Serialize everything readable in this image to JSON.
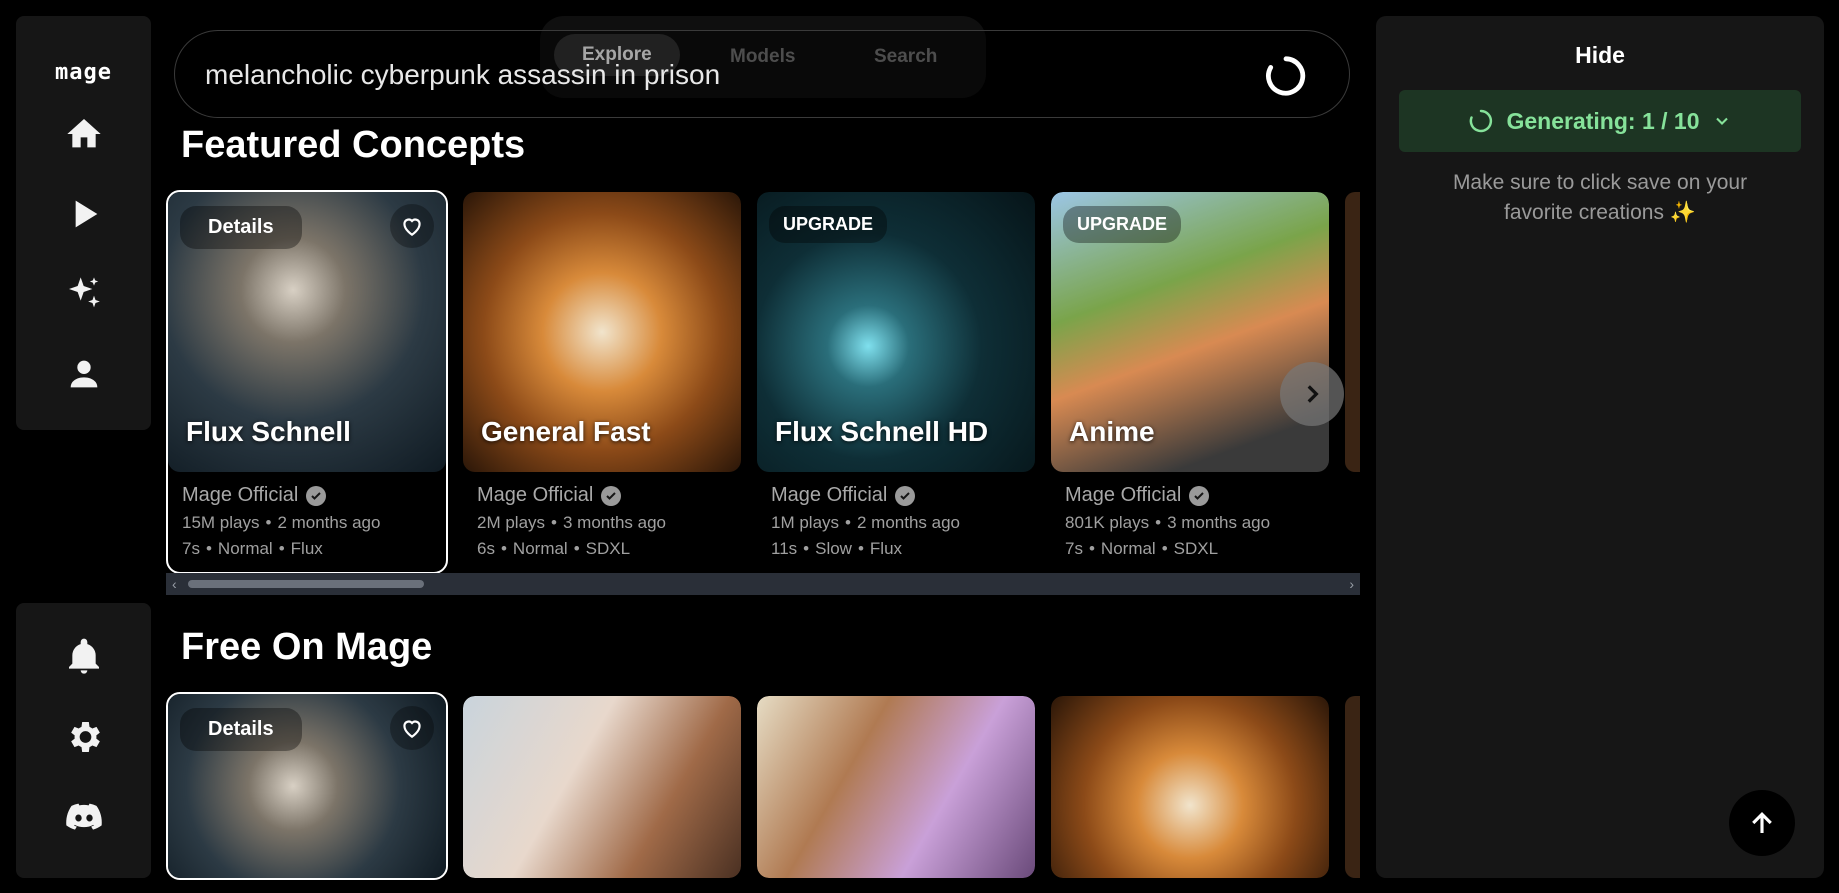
{
  "logo": "mage",
  "tabs": [
    {
      "label": "Explore"
    },
    {
      "label": "Models"
    },
    {
      "label": "Search"
    }
  ],
  "search": {
    "value": "melancholic cyberpunk assassin in prison"
  },
  "featured": {
    "title": "Featured Concepts",
    "cards": [
      {
        "title": "Flux Schnell",
        "badge": "Details",
        "author": "Mage Official",
        "plays": "15M plays",
        "age": "2 months ago",
        "time": "7s",
        "speed": "Normal",
        "model": "Flux"
      },
      {
        "title": "General Fast",
        "badge": "",
        "author": "Mage Official",
        "plays": "2M plays",
        "age": "3 months ago",
        "time": "6s",
        "speed": "Normal",
        "model": "SDXL"
      },
      {
        "title": "Flux Schnell HD",
        "badge": "UPGRADE",
        "author": "Mage Official",
        "plays": "1M plays",
        "age": "2 months ago",
        "time": "11s",
        "speed": "Slow",
        "model": "Flux"
      },
      {
        "title": "Anime",
        "badge": "UPGRADE",
        "author": "Mage Official",
        "plays": "801K plays",
        "age": "3 months ago",
        "time": "7s",
        "speed": "Normal",
        "model": "SDXL"
      }
    ]
  },
  "free": {
    "title": "Free On Mage",
    "cards": [
      {
        "badge": "Details"
      }
    ]
  },
  "panel": {
    "hide_label": "Hide",
    "generating_label": "Generating: 1 / 10",
    "note": "Make sure to click save on your favorite creations ✨"
  },
  "colors": {
    "generating_text": "#86e29a",
    "generating_bg": "#1d3523",
    "panel_bg": "#161616"
  }
}
